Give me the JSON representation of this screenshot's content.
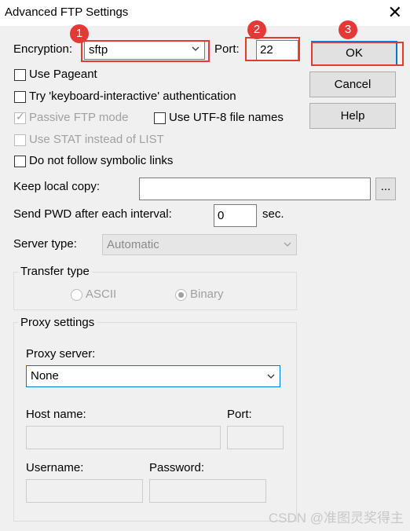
{
  "window": {
    "title": "Advanced FTP Settings",
    "close_glyph": "✕"
  },
  "encryption": {
    "label": "Encryption:",
    "value": "sftp"
  },
  "port": {
    "label": "Port:",
    "value": "22"
  },
  "buttons": {
    "ok": "OK",
    "cancel": "Cancel",
    "help": "Help",
    "browse": "..."
  },
  "options": {
    "use_pageant": "Use Pageant",
    "keyboard_interactive": "Try 'keyboard-interactive' authentication",
    "passive_ftp": "Passive FTP mode",
    "utf8": "Use UTF-8 file names",
    "use_stat": "Use STAT instead of LIST",
    "no_symlinks": "Do not follow symbolic links"
  },
  "keep_local_copy": {
    "label": "Keep local copy:",
    "value": ""
  },
  "send_pwd": {
    "label": "Send PWD after each interval:",
    "value": "0",
    "unit": "sec."
  },
  "server_type": {
    "label": "Server type:",
    "value": "Automatic"
  },
  "transfer_type": {
    "title": "Transfer type",
    "ascii": "ASCII",
    "binary": "Binary"
  },
  "proxy": {
    "title": "Proxy settings",
    "server_label": "Proxy server:",
    "server_value": "None",
    "host_label": "Host name:",
    "port_label": "Port:",
    "username_label": "Username:",
    "password_label": "Password:"
  },
  "annotations": {
    "badge1": "1",
    "badge2": "2",
    "badge3": "3"
  },
  "watermark": "CSDN @准图灵奖得主",
  "colors": {
    "annotation_red": "#e53935",
    "dialog_bg": "#f0f0f0",
    "ok_border": "#0078d7"
  },
  "icons": {
    "close": "close-icon",
    "dropdown": "chevron-down-icon"
  }
}
